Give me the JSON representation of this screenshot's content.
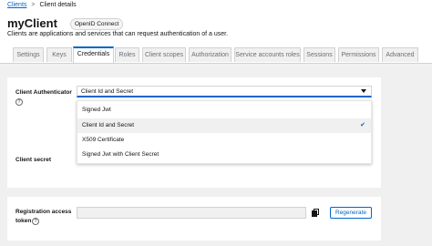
{
  "breadcrumb": {
    "root": "Clients",
    "separator": ">",
    "current": "Client details"
  },
  "header": {
    "title": "myClient",
    "badge": "OpenID Connect",
    "subtitle": "Clients are applications and services that can request authentication of a user."
  },
  "tabs": [
    {
      "label": "Settings"
    },
    {
      "label": "Keys"
    },
    {
      "label": "Credentials"
    },
    {
      "label": "Roles"
    },
    {
      "label": "Client scopes"
    },
    {
      "label": "Authorization"
    },
    {
      "label": "Service accounts roles"
    },
    {
      "label": "Sessions"
    },
    {
      "label": "Permissions"
    },
    {
      "label": "Advanced"
    }
  ],
  "active_tab": "Credentials",
  "authenticator": {
    "label": "Client Authenticator",
    "selected": "Client Id and Secret",
    "options": [
      {
        "label": "Signed Jwt"
      },
      {
        "label": "Client Id and Secret"
      },
      {
        "label": "X509 Certificate"
      },
      {
        "label": "Signed Jwt with Client Secret"
      }
    ]
  },
  "secret": {
    "label": "Client secret"
  },
  "registration": {
    "label_line1": "Registration access",
    "label_line2": "token",
    "regenerate_label": "Regenerate"
  },
  "icons": {
    "help": "help-icon",
    "caret": "caret-down-icon",
    "check": "check-icon",
    "copy": "copy-icon"
  },
  "colors": {
    "accent": "#0066cc",
    "page_bg": "#f0f0f0"
  }
}
